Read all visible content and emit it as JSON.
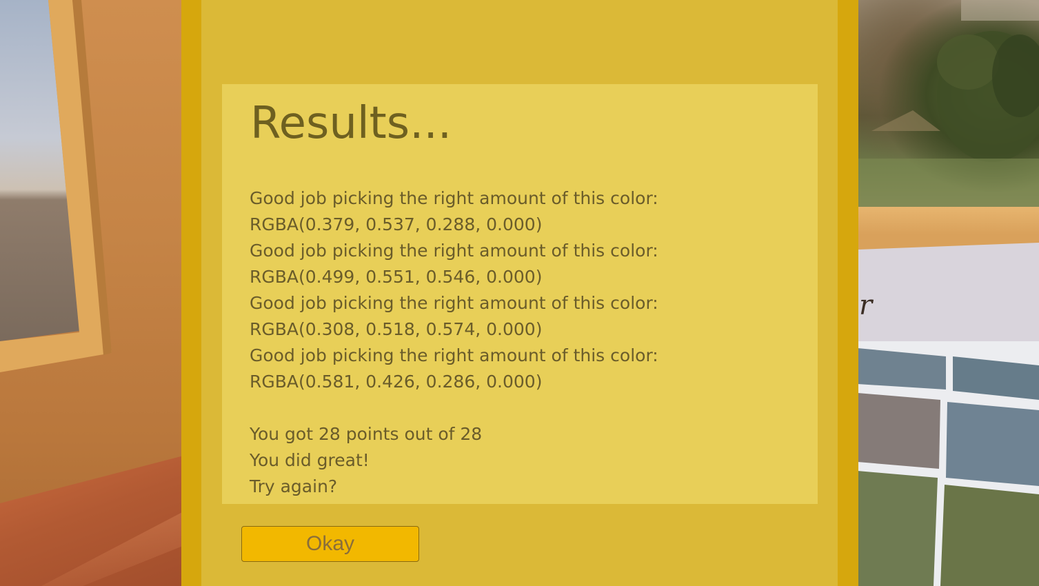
{
  "dialog": {
    "title": "Results...",
    "results": [
      {
        "message": "Good job picking the right amount of this color:",
        "color": "RGBA(0.379, 0.537, 0.288, 0.000)"
      },
      {
        "message": "Good job picking the right amount of this color:",
        "color": "RGBA(0.499, 0.551, 0.546, 0.000)"
      },
      {
        "message": "Good job picking the right amount of this color:",
        "color": "RGBA(0.308, 0.518, 0.574, 0.000)"
      },
      {
        "message": "Good job picking the right amount of this color:",
        "color": "RGBA(0.581, 0.426, 0.286, 0.000)"
      }
    ],
    "score_text": "You got 28 points out of 28",
    "feedback": "You did great!",
    "prompt": "Try again?",
    "okay_label": "Okay"
  },
  "scene": {
    "board_text": "r"
  },
  "colors": {
    "dialog_frame": "#d6a70d",
    "dialog_panel": "#dbb937",
    "content_panel": "#e8cf58",
    "button": "#f2b800"
  }
}
